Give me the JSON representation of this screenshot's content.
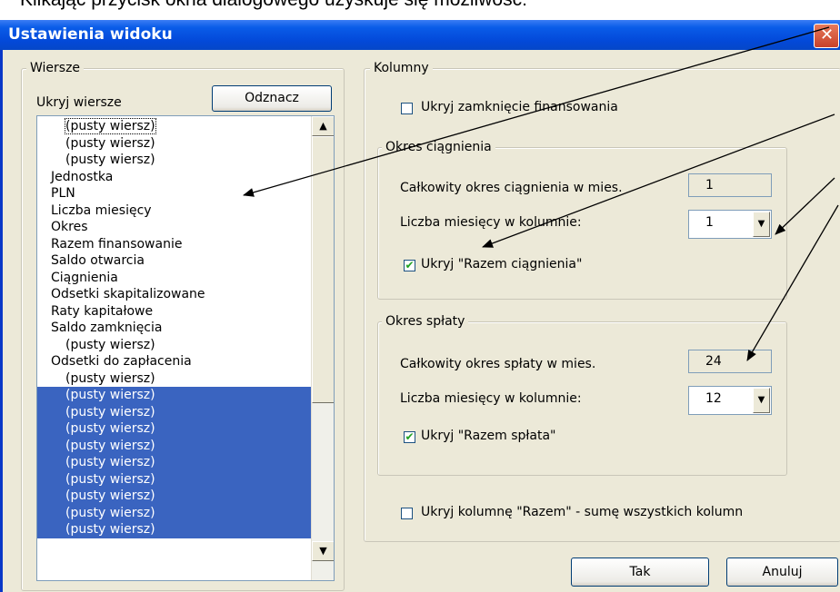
{
  "doc": {
    "text": "Klikając przycisk okna dialogowego uzyskuje się możliwość:"
  },
  "window": {
    "title": "Ustawienia widoku"
  },
  "rows_group": {
    "legend": "Wiersze",
    "hide_label": "Ukryj wiersze",
    "uncheck_button": "Odznacz",
    "items": [
      {
        "text": "(pusty wiersz)",
        "indent": true,
        "selected": false,
        "focus": true
      },
      {
        "text": "(pusty wiersz)",
        "indent": true,
        "selected": false
      },
      {
        "text": "(pusty wiersz)",
        "indent": true,
        "selected": false
      },
      {
        "text": "Jednostka",
        "indent": false,
        "selected": false
      },
      {
        "text": "PLN",
        "indent": false,
        "selected": false
      },
      {
        "text": "Liczba miesięcy",
        "indent": false,
        "selected": false
      },
      {
        "text": "Okres",
        "indent": false,
        "selected": false
      },
      {
        "text": "Razem finansowanie",
        "indent": false,
        "selected": false
      },
      {
        "text": "Saldo otwarcia",
        "indent": false,
        "selected": false
      },
      {
        "text": "Ciągnienia",
        "indent": false,
        "selected": false
      },
      {
        "text": "Odsetki skapitalizowane",
        "indent": false,
        "selected": false
      },
      {
        "text": "Raty kapitałowe",
        "indent": false,
        "selected": false
      },
      {
        "text": "Saldo zamknięcia",
        "indent": false,
        "selected": false
      },
      {
        "text": "(pusty wiersz)",
        "indent": true,
        "selected": false
      },
      {
        "text": "Odsetki do zapłacenia",
        "indent": false,
        "selected": false
      },
      {
        "text": "(pusty wiersz)",
        "indent": true,
        "selected": false
      },
      {
        "text": "(pusty wiersz)",
        "indent": true,
        "selected": true
      },
      {
        "text": "(pusty wiersz)",
        "indent": true,
        "selected": true
      },
      {
        "text": "(pusty wiersz)",
        "indent": true,
        "selected": true
      },
      {
        "text": "(pusty wiersz)",
        "indent": true,
        "selected": true
      },
      {
        "text": "(pusty wiersz)",
        "indent": true,
        "selected": true
      },
      {
        "text": "(pusty wiersz)",
        "indent": true,
        "selected": true
      },
      {
        "text": "(pusty wiersz)",
        "indent": true,
        "selected": true
      },
      {
        "text": "(pusty wiersz)",
        "indent": true,
        "selected": true
      },
      {
        "text": "(pusty wiersz)",
        "indent": true,
        "selected": true
      }
    ]
  },
  "columns_group": {
    "legend": "Kolumny",
    "hide_financing_close": {
      "label": "Ukryj zamknięcie finansowania",
      "checked": false
    },
    "draw_period": {
      "legend": "Okres ciągnienia",
      "total_label": "Całkowity okres ciągnienia w mies.",
      "total_value": "1",
      "months_label": "Liczba miesięcy w kolumnie:",
      "months_value": "1",
      "hide_total": {
        "label": "Ukryj \"Razem ciągnienia\"",
        "checked": true
      }
    },
    "repay_period": {
      "legend": "Okres spłaty",
      "total_label": "Całkowity okres spłaty w mies.",
      "total_value": "24",
      "months_label": "Liczba miesięcy w kolumnie:",
      "months_value": "12",
      "hide_total": {
        "label": "Ukryj \"Razem spłata\"",
        "checked": true
      }
    },
    "hide_total_column": {
      "label": "Ukryj kolumnę \"Razem\" - sumę wszystkich kolumn",
      "checked": false
    }
  },
  "buttons": {
    "ok": "Tak",
    "cancel": "Anuluj"
  },
  "colors": {
    "titlebar": "#0a5ce8",
    "selection": "#3a64c0",
    "dialog_bg": "#ece9d8"
  }
}
